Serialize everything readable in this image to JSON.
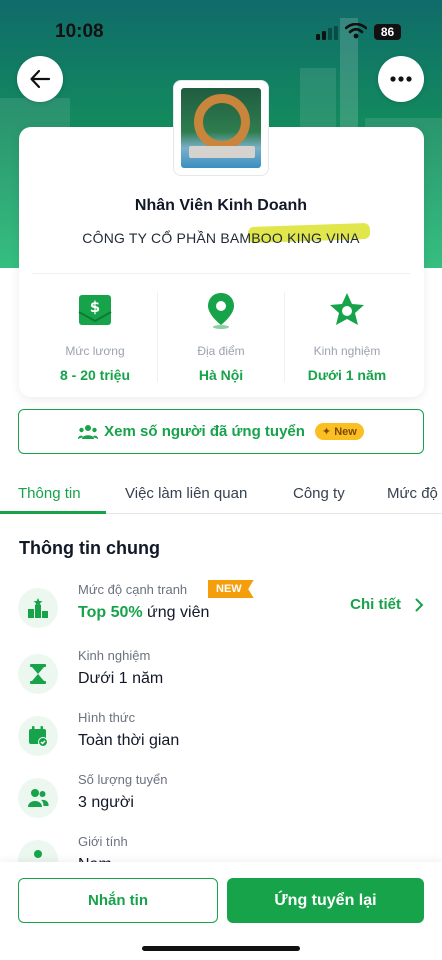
{
  "status_bar": {
    "time": "10:08",
    "battery": "86"
  },
  "header": {
    "back_icon": "arrow-left-icon",
    "more_icon": "more-dots-icon"
  },
  "job": {
    "title": "Nhân Viên Kinh Doanh",
    "company": "CÔNG TY CỔ PHẦN BAMBOO KING VINA"
  },
  "summary": [
    {
      "icon": "money-envelope-icon",
      "label": "Mức lương",
      "value": "8 - 20 triệu"
    },
    {
      "icon": "location-pin-icon",
      "label": "Địa điểm",
      "value": "Hà Nội"
    },
    {
      "icon": "star-badge-icon",
      "label": "Kinh nghiệm",
      "value": "Dưới 1 năm"
    }
  ],
  "applicants": {
    "label": "Xem số người đã ứng tuyển",
    "badge": "✦ New"
  },
  "tabs": [
    "Thông tin",
    "Việc làm liên quan",
    "Công ty",
    "Mức độ"
  ],
  "general": {
    "title": "Thông tin chung",
    "competition": {
      "label": "Mức độ cạnh tranh",
      "tag": "NEW",
      "value_highlight": "Top 50%",
      "value_rest": " ứng viên",
      "link": "Chi tiết"
    },
    "items": [
      {
        "icon": "hourglass-icon",
        "label": "Kinh nghiệm",
        "value": "Dưới 1 năm"
      },
      {
        "icon": "calendar-icon",
        "label": "Hình thức",
        "value": "Toàn thời gian"
      },
      {
        "icon": "people-icon",
        "label": "Số lượng tuyển",
        "value": "3 người"
      },
      {
        "icon": "person-icon",
        "label": "Giới tính",
        "value": "Nam"
      }
    ]
  },
  "actions": {
    "message": "Nhắn tin",
    "apply": "Ứng tuyển lại"
  },
  "colors": {
    "accent": "#16a34a",
    "new_tag": "#f59e0b",
    "pill": "#fbbf24"
  }
}
